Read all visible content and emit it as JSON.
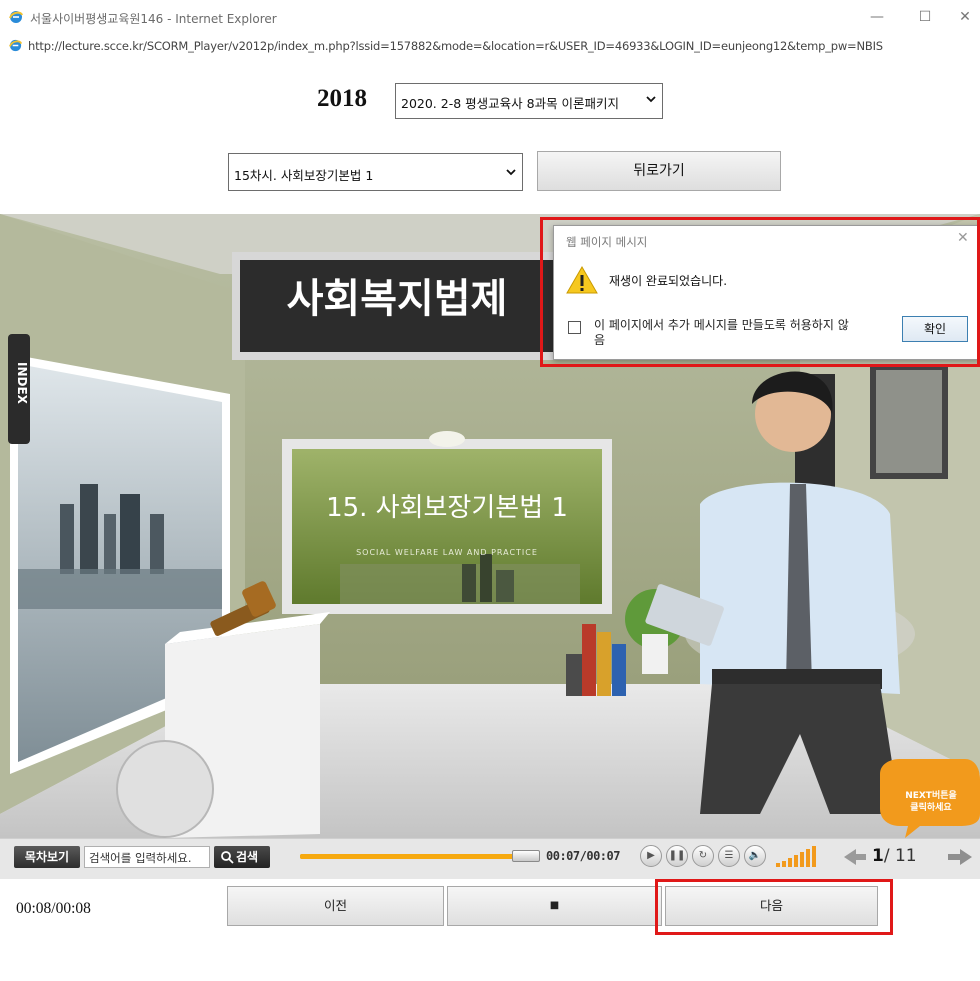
{
  "window": {
    "title": "서울사이버평생교육원146 - Internet Explorer",
    "address": "http://lecture.scce.kr/SCORM_Player/v2012p/index_m.php?lssid=157882&mode=&location=r&USER_ID=46933&LOGIN_ID=eunjeong12&temp_pw=NBIS"
  },
  "header": {
    "year": "2018",
    "course_select": "2020. 2-8 평생교육사 8과목 이론패키지",
    "chapter_select": "15차시. 사회보장기본법 1",
    "back_button": "뒤로가기"
  },
  "stage": {
    "banner_title": "사회복지법제",
    "slide_title": "15. 사회보장기본법 1",
    "slide_subtitle": "SOCIAL WELFARE LAW AND PRACTICE",
    "index_tab": "INDEX",
    "next_hint_line1": "NEXT버튼을",
    "next_hint_line2": "클릭하세요"
  },
  "player": {
    "toc_button": "목차보기",
    "search_placeholder": "검색어를 입력하세요.",
    "search_button": "검색",
    "time": "00:07/00:07",
    "progress": 1.0,
    "page_current": "1",
    "page_total": "/ 11"
  },
  "footer": {
    "elapsed": "00:08/00:08",
    "prev_button": "이전",
    "stop_button": "■",
    "next_button": "다음"
  },
  "dialog": {
    "title": "웹 페이지 메시지",
    "message": "재생이 완료되었습니다.",
    "checkbox_label": "이 페이지에서 추가 메시지를 만들도록 허용하지 않음",
    "ok_button": "확인"
  },
  "colors": {
    "highlight": "#e01818",
    "progress": "#f6a90f",
    "slide_green": "#6f8a3a"
  }
}
